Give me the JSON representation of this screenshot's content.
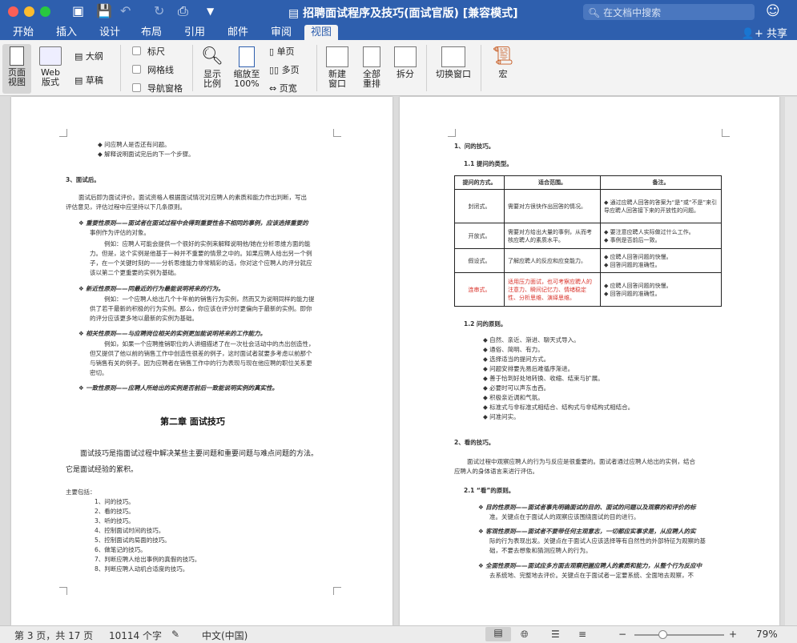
{
  "window": {
    "title": "招聘面试程序及技巧(面试官版) [兼容模式]",
    "search_placeholder": "在文档中搜索"
  },
  "tabs": [
    "开始",
    "插入",
    "设计",
    "布局",
    "引用",
    "邮件",
    "审阅",
    "视图"
  ],
  "active_tab": "视图",
  "share_label": "共享",
  "ribbon": {
    "page_view": "页面\n视图",
    "web_layout": "Web\n版式",
    "outline": "大纲",
    "draft": "草稿",
    "ruler": "标尺",
    "gridlines": "网格线",
    "nav_pane": "导航窗格",
    "show_ratio": "显示\n比例",
    "zoom_100": "缩放至\n100%",
    "one_page": "单页",
    "multi_page": "多页",
    "page_width": "页宽",
    "new_window": "新建\n窗口",
    "arrange_all": "全部\n重排",
    "split": "拆分",
    "switch_window": "切换窗口",
    "macros": "宏"
  },
  "left_page": {
    "bullets_top": [
      "问应聘人是否还有问题。",
      "解释说明面试完后的下一个步骤。"
    ],
    "sec3_title": "3、面试后。",
    "sec3_para": [
      "面试后即为面试评价。面试资格人根据面试情况对应聘人的素质和能力作出判断，写出",
      "评估意见，评估过程中应坚持以下几条原则。"
    ],
    "p1": [
      "重要性原则——面试者在面试过程中会得到重要性各不相同的事例，应该选择重要的",
      "事例作为评估的对象。",
      "例如：应聘人可能会提供一个很好的实例来解释说明他/她在分析思维方面的能",
      "力。但是，这个实例是他基于一种并不重要的情景之中的。如果应聘人给出另一个例",
      "子，在一个关键时刻的——分析思维能力非常精彩的话，你对这个应聘人的评分就应",
      "该以第二个更重要的实例为基础。"
    ],
    "p2": [
      "新近性原则——同最近的行为最能说明将来的行为。",
      "例如：一个应聘人给出几个十年前的销售行为实例，然而又为说明同样的能力提",
      "供了若干最新的积极的行为实例。那么，你应该在评分时更偏向于最新的实例。即你",
      "的评分应该更多地以最新的实例为基础。"
    ],
    "p3": [
      "相关性原则——与应聘岗位相关的实例更加能说明将来的工作能力。",
      "例如，如果一个应聘推销职位的人讲细描述了在一次社会活动中的杰出创造性，",
      "但又提供了他以前的销售工作中创造性很差的例子，这时面试者就要多考虑以前那个",
      "与销售有关的例子。因为应聘者在销售工作中的行为表现与现在他应聘的职位关系更",
      "密切。"
    ],
    "p4": "一致性原则——应聘人所给出的实例是否前后一致能说明实例的真实性。",
    "chapter": "第二章    面试技巧",
    "intro": [
      "面试技巧是指面试过程中解决某些主要问题和重要问题与难点问题的方法。",
      "它是面试经验的累积。"
    ],
    "includes": "主要包括：",
    "list": [
      "1、问的技巧。",
      "2、看的技巧。",
      "3、听的技巧。",
      "4、控制面试时间的技巧。",
      "5、控制面试的局面的技巧。",
      "6、做笔记的技巧。",
      "7、判断应聘人给出事例的真假的技巧。",
      "8、判断应聘人动机合适度的技巧。"
    ]
  },
  "right_page": {
    "s1": "1、问的技巧。",
    "s11": "1.1    提问的类型。",
    "table_header": [
      "提问的方式。",
      "适合范围。",
      "备注。"
    ],
    "table_rows": [
      [
        "封闭式。",
        "需要对方很快作出回答的情况。",
        "通过应聘人回答的答案为“是”或“不是”来引导应聘人回答接下来的开放性的问题。"
      ],
      [
        "开放式。",
        "需要对方给出大量的事例，从而考核应聘人的素质水平。",
        "要注意应聘人实际做过什么工作。|事例是否前后一致。"
      ],
      [
        "假设式。",
        "了解应聘人的反应和应变能力。",
        "应聘人回答问题的快慢。|回答问题的准确性。"
      ],
      [
        "连串式。",
        "适用压力面试，也可考察应聘人的注意力、瞬间记忆力、情绪稳定性、分析思维、演绎思维。",
        "应聘人回答问题的快慢。|回答问题的准确性。"
      ]
    ],
    "s12": "1.2    问的原则。",
    "s12_list": [
      "自然、亲近、渐进、聊天式导入。",
      "通俗、简明、有力。",
      "选择适当的提问方式。",
      "问题安排要先易后难循序渐进。",
      "善于恰到好处地转换、收缩、结束与扩展。",
      "必要时可以声东击西。",
      "积极亲近调和气氛。",
      "标准式与非标准式相结合、结构式与非结构式相结合。",
      "问准问实。"
    ],
    "s2": "2、看的技巧。",
    "s2_para": [
      "面试过程中观察应聘人的行为与反应是很重要的。面试者通过应聘人给出的实例，结合",
      "应聘人的身体语言来进行评估。"
    ],
    "s21": "2.1    “看”的原则。",
    "s21_items": [
      [
        "目的性原则——面试者事先明确面试的目的、面试的问题以及观察的和评价的标",
        "准。关键点在于面试人的观察应该围绕面试的目的进行。"
      ],
      [
        "客观性原则——面试者不要带任何主观意志，一切都应实事求是，从应聘人的实",
        "际的行为表现出发。关键点在于面试人应该选择等有自然性的外部特征为观察的基",
        "础，不要去想象和猜测应聘人的行为。"
      ],
      [
        "全面性原则——面试应多方面去观察把握应聘人的素质和能力，从整个行为反应中",
        "去系统地、完整地去评价。关键点在于面试者一定要系统、全面地去观察，不"
      ]
    ]
  },
  "status": {
    "page": "第 3 页，共 17 页",
    "words": "10114 个字",
    "language": "中文(中国)",
    "zoom": "79%"
  },
  "colors": {
    "accent": "#2e5fae",
    "highlight_red": "#d9322a"
  }
}
